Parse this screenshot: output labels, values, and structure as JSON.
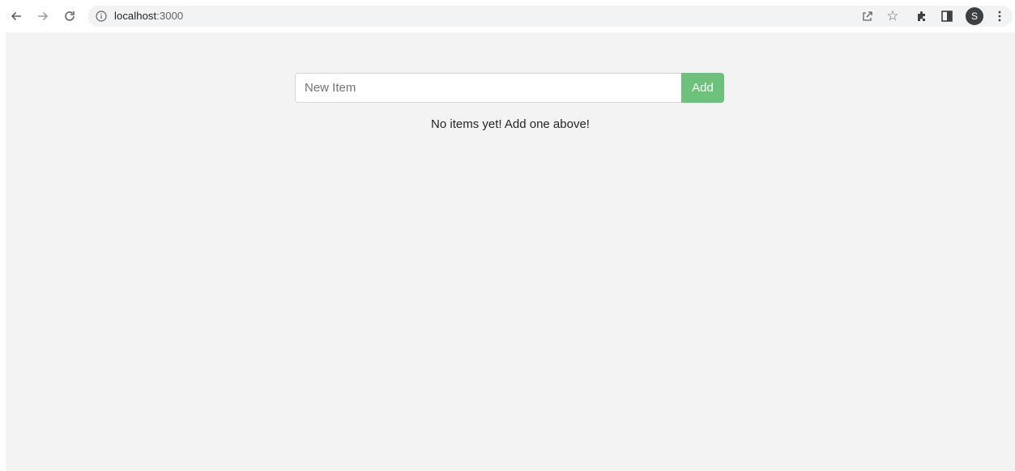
{
  "browser": {
    "url_host": "localhost",
    "url_port": ":3000",
    "profile_initial": "S"
  },
  "app": {
    "input_placeholder": "New Item",
    "add_label": "Add",
    "empty_message": "No items yet! Add one above!"
  },
  "colors": {
    "page_background": "#f3f3f3",
    "add_button": "#6cc27b"
  }
}
